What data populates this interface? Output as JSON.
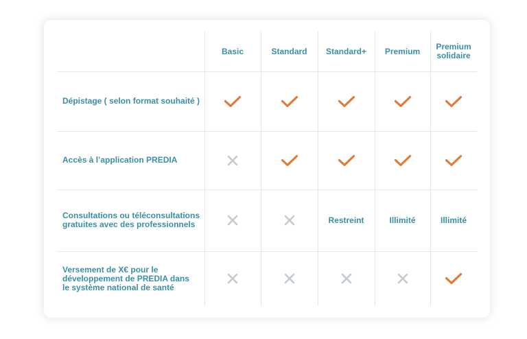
{
  "colors": {
    "accent_text": "#3a8fa8",
    "check": "#e07b39",
    "cross": "#c3cad0",
    "grid": "#e4e7ea"
  },
  "table": {
    "plans": [
      "Basic",
      "Standard",
      "Standard+",
      "Premium",
      "Premium\nsolidaire"
    ],
    "rows": [
      {
        "label": "Dépistage ( selon format souhaité )",
        "cells": [
          {
            "type": "check"
          },
          {
            "type": "check"
          },
          {
            "type": "check"
          },
          {
            "type": "check"
          },
          {
            "type": "check"
          }
        ]
      },
      {
        "label": "Accès à l’application PREDIA",
        "cells": [
          {
            "type": "cross"
          },
          {
            "type": "check"
          },
          {
            "type": "check"
          },
          {
            "type": "check"
          },
          {
            "type": "check"
          }
        ]
      },
      {
        "label": "Consultations ou téléconsultations\ngratuites avec des professionnels",
        "cells": [
          {
            "type": "cross"
          },
          {
            "type": "cross"
          },
          {
            "type": "text",
            "value": "Restreint"
          },
          {
            "type": "text",
            "value": "Illimité"
          },
          {
            "type": "text",
            "value": "Illimité"
          }
        ]
      },
      {
        "label": "Versement de X€ pour le\ndéveloppement de PREDIA dans\nle système national de santé",
        "cells": [
          {
            "type": "cross"
          },
          {
            "type": "cross"
          },
          {
            "type": "cross"
          },
          {
            "type": "cross"
          },
          {
            "type": "check"
          }
        ]
      }
    ]
  }
}
